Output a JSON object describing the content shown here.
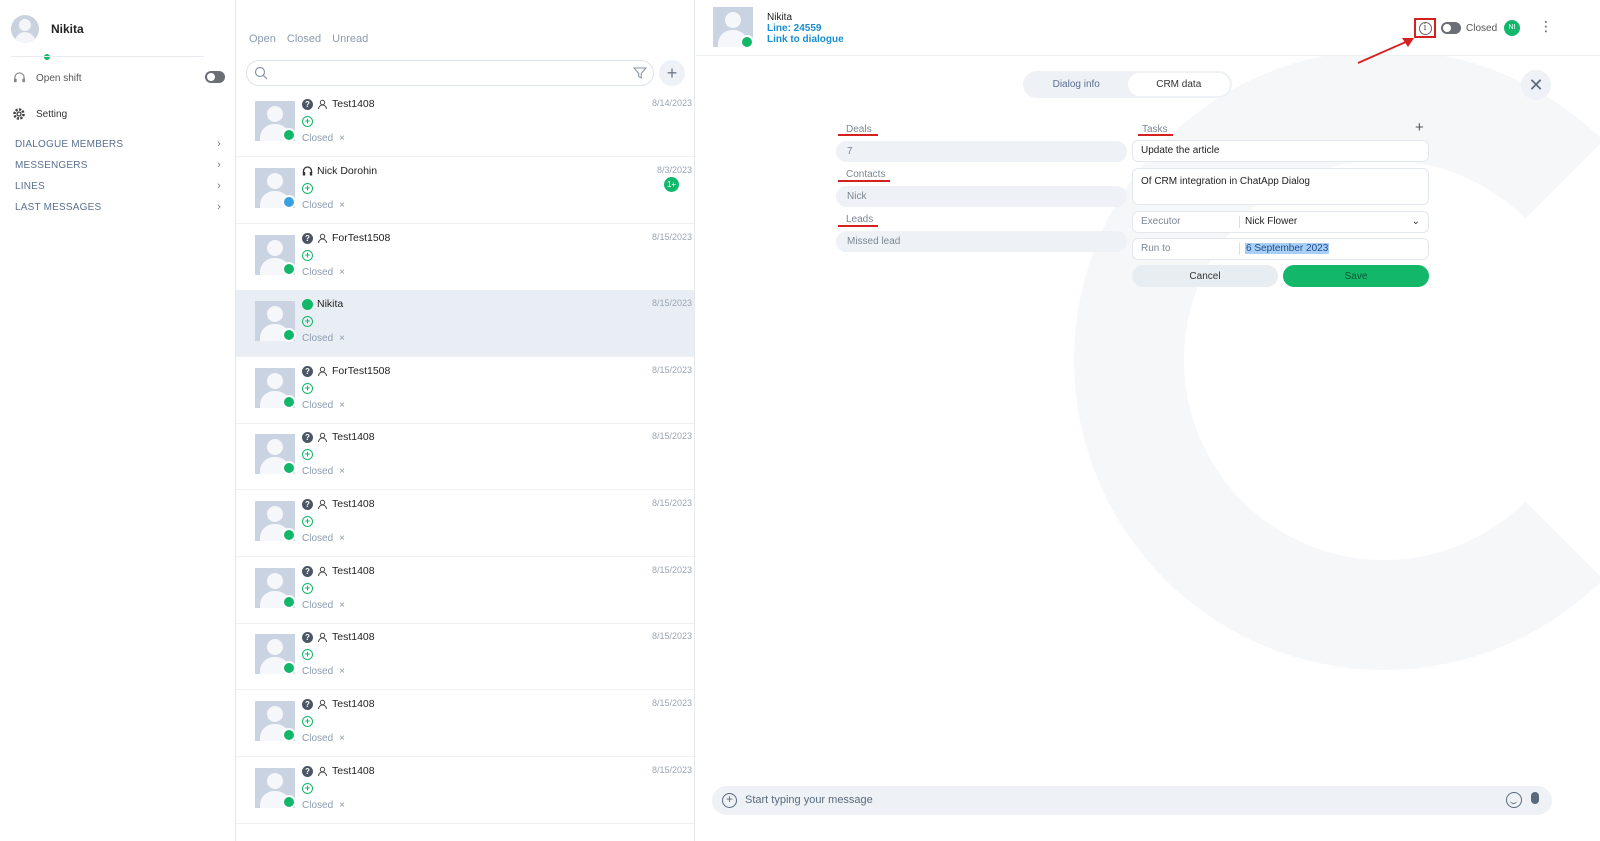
{
  "sidebar": {
    "user_name": "Nikita",
    "open_shift_label": "Open shift",
    "setting_label": "Setting",
    "sections": [
      "DIALOGUE MEMBERS",
      "MESSENGERS",
      "LINES",
      "LAST MESSAGES"
    ]
  },
  "list": {
    "tabs": [
      "Open",
      "Closed",
      "Unread"
    ],
    "search_placeholder": "",
    "items": [
      {
        "name": "Test1408",
        "date": "8/14/2023",
        "status": "Closed",
        "icon": "question"
      },
      {
        "name": "Nick Dorohin",
        "date": "8/3/2023",
        "status": "Closed",
        "icon": "headset",
        "unread": "1+"
      },
      {
        "name": "ForTest1508",
        "date": "8/15/2023",
        "status": "Closed",
        "icon": "question"
      },
      {
        "name": "Nikita",
        "date": "8/15/2023",
        "status": "Closed",
        "icon": "green-dot"
      },
      {
        "name": "ForTest1508",
        "date": "8/15/2023",
        "status": "Closed",
        "icon": "question"
      },
      {
        "name": "Test1408",
        "date": "8/15/2023",
        "status": "Closed",
        "icon": "question"
      },
      {
        "name": "Test1408",
        "date": "8/15/2023",
        "status": "Closed",
        "icon": "question"
      },
      {
        "name": "Test1408",
        "date": "8/15/2023",
        "status": "Closed",
        "icon": "question"
      },
      {
        "name": "Test1408",
        "date": "8/15/2023",
        "status": "Closed",
        "icon": "question"
      },
      {
        "name": "Test1408",
        "date": "8/15/2023",
        "status": "Closed",
        "icon": "question"
      },
      {
        "name": "Test1408",
        "date": "8/15/2023",
        "status": "Closed",
        "icon": "question"
      }
    ]
  },
  "chat": {
    "contact_name": "Nikita",
    "line": "Line: 24559",
    "link": "Link to dialogue",
    "status_label": "Closed",
    "operator_initials": "NI",
    "tabs": {
      "dialog_info": "Dialog info",
      "crm_data": "CRM data"
    },
    "crm": {
      "deals_label": "Deals",
      "deals_value": "7",
      "contacts_label": "Contacts",
      "contacts_value": "Nick",
      "leads_label": "Leads",
      "leads_value": "Missed lead",
      "tasks_label": "Tasks",
      "task_title": "Update the article",
      "task_description": "Of CRM integration in ChatApp Dialog",
      "executor_label": "Executor",
      "executor_value": "Nick Flower",
      "run_to_label": "Run to",
      "run_to_value": "6 September 2023",
      "cancel_label": "Cancel",
      "save_label": "Save"
    },
    "composer_placeholder": "Start typing your message"
  },
  "colors": {
    "accent_green": "#12b76a",
    "link_blue": "#1a8fd0",
    "annotation_red": "#d61f1f"
  }
}
